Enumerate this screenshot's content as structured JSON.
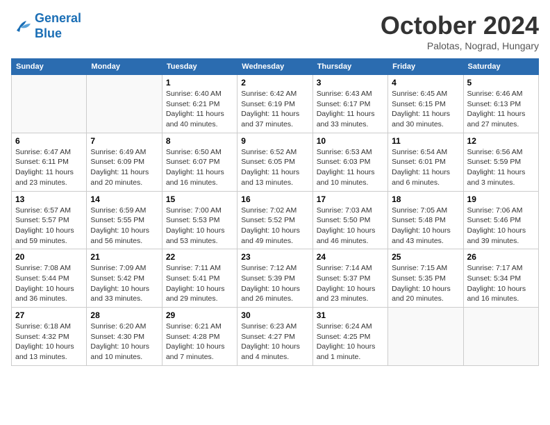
{
  "header": {
    "logo_line1": "General",
    "logo_line2": "Blue",
    "month": "October 2024",
    "location": "Palotas, Nograd, Hungary"
  },
  "weekdays": [
    "Sunday",
    "Monday",
    "Tuesday",
    "Wednesday",
    "Thursday",
    "Friday",
    "Saturday"
  ],
  "weeks": [
    [
      {
        "day": "",
        "info": ""
      },
      {
        "day": "",
        "info": ""
      },
      {
        "day": "1",
        "info": "Sunrise: 6:40 AM\nSunset: 6:21 PM\nDaylight: 11 hours and 40 minutes."
      },
      {
        "day": "2",
        "info": "Sunrise: 6:42 AM\nSunset: 6:19 PM\nDaylight: 11 hours and 37 minutes."
      },
      {
        "day": "3",
        "info": "Sunrise: 6:43 AM\nSunset: 6:17 PM\nDaylight: 11 hours and 33 minutes."
      },
      {
        "day": "4",
        "info": "Sunrise: 6:45 AM\nSunset: 6:15 PM\nDaylight: 11 hours and 30 minutes."
      },
      {
        "day": "5",
        "info": "Sunrise: 6:46 AM\nSunset: 6:13 PM\nDaylight: 11 hours and 27 minutes."
      }
    ],
    [
      {
        "day": "6",
        "info": "Sunrise: 6:47 AM\nSunset: 6:11 PM\nDaylight: 11 hours and 23 minutes."
      },
      {
        "day": "7",
        "info": "Sunrise: 6:49 AM\nSunset: 6:09 PM\nDaylight: 11 hours and 20 minutes."
      },
      {
        "day": "8",
        "info": "Sunrise: 6:50 AM\nSunset: 6:07 PM\nDaylight: 11 hours and 16 minutes."
      },
      {
        "day": "9",
        "info": "Sunrise: 6:52 AM\nSunset: 6:05 PM\nDaylight: 11 hours and 13 minutes."
      },
      {
        "day": "10",
        "info": "Sunrise: 6:53 AM\nSunset: 6:03 PM\nDaylight: 11 hours and 10 minutes."
      },
      {
        "day": "11",
        "info": "Sunrise: 6:54 AM\nSunset: 6:01 PM\nDaylight: 11 hours and 6 minutes."
      },
      {
        "day": "12",
        "info": "Sunrise: 6:56 AM\nSunset: 5:59 PM\nDaylight: 11 hours and 3 minutes."
      }
    ],
    [
      {
        "day": "13",
        "info": "Sunrise: 6:57 AM\nSunset: 5:57 PM\nDaylight: 10 hours and 59 minutes."
      },
      {
        "day": "14",
        "info": "Sunrise: 6:59 AM\nSunset: 5:55 PM\nDaylight: 10 hours and 56 minutes."
      },
      {
        "day": "15",
        "info": "Sunrise: 7:00 AM\nSunset: 5:53 PM\nDaylight: 10 hours and 53 minutes."
      },
      {
        "day": "16",
        "info": "Sunrise: 7:02 AM\nSunset: 5:52 PM\nDaylight: 10 hours and 49 minutes."
      },
      {
        "day": "17",
        "info": "Sunrise: 7:03 AM\nSunset: 5:50 PM\nDaylight: 10 hours and 46 minutes."
      },
      {
        "day": "18",
        "info": "Sunrise: 7:05 AM\nSunset: 5:48 PM\nDaylight: 10 hours and 43 minutes."
      },
      {
        "day": "19",
        "info": "Sunrise: 7:06 AM\nSunset: 5:46 PM\nDaylight: 10 hours and 39 minutes."
      }
    ],
    [
      {
        "day": "20",
        "info": "Sunrise: 7:08 AM\nSunset: 5:44 PM\nDaylight: 10 hours and 36 minutes."
      },
      {
        "day": "21",
        "info": "Sunrise: 7:09 AM\nSunset: 5:42 PM\nDaylight: 10 hours and 33 minutes."
      },
      {
        "day": "22",
        "info": "Sunrise: 7:11 AM\nSunset: 5:41 PM\nDaylight: 10 hours and 29 minutes."
      },
      {
        "day": "23",
        "info": "Sunrise: 7:12 AM\nSunset: 5:39 PM\nDaylight: 10 hours and 26 minutes."
      },
      {
        "day": "24",
        "info": "Sunrise: 7:14 AM\nSunset: 5:37 PM\nDaylight: 10 hours and 23 minutes."
      },
      {
        "day": "25",
        "info": "Sunrise: 7:15 AM\nSunset: 5:35 PM\nDaylight: 10 hours and 20 minutes."
      },
      {
        "day": "26",
        "info": "Sunrise: 7:17 AM\nSunset: 5:34 PM\nDaylight: 10 hours and 16 minutes."
      }
    ],
    [
      {
        "day": "27",
        "info": "Sunrise: 6:18 AM\nSunset: 4:32 PM\nDaylight: 10 hours and 13 minutes."
      },
      {
        "day": "28",
        "info": "Sunrise: 6:20 AM\nSunset: 4:30 PM\nDaylight: 10 hours and 10 minutes."
      },
      {
        "day": "29",
        "info": "Sunrise: 6:21 AM\nSunset: 4:28 PM\nDaylight: 10 hours and 7 minutes."
      },
      {
        "day": "30",
        "info": "Sunrise: 6:23 AM\nSunset: 4:27 PM\nDaylight: 10 hours and 4 minutes."
      },
      {
        "day": "31",
        "info": "Sunrise: 6:24 AM\nSunset: 4:25 PM\nDaylight: 10 hours and 1 minute."
      },
      {
        "day": "",
        "info": ""
      },
      {
        "day": "",
        "info": ""
      }
    ]
  ]
}
